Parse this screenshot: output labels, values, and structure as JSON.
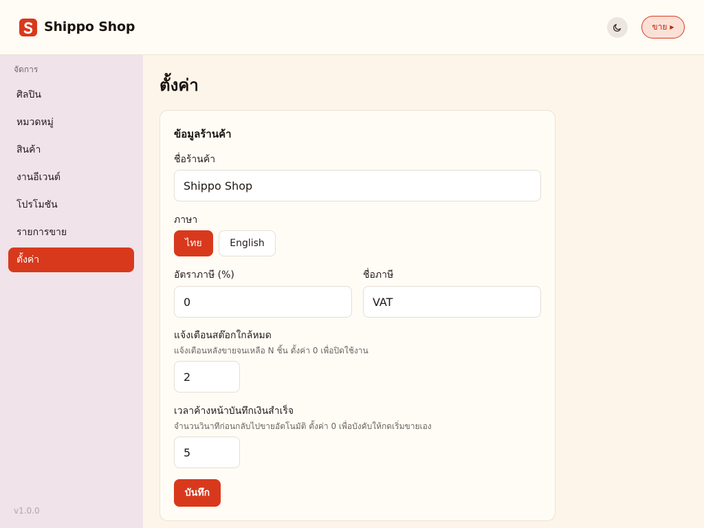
{
  "header": {
    "brand": "Shippo Shop",
    "sell_label": "ขาย",
    "sell_arrow": "▶"
  },
  "sidebar": {
    "heading": "จัดการ",
    "items": [
      {
        "label": "ศิลปิน"
      },
      {
        "label": "หมวดหมู่"
      },
      {
        "label": "สินค้า"
      },
      {
        "label": "งานอีเวนต์"
      },
      {
        "label": "โปรโมชัน"
      },
      {
        "label": "รายการขาย"
      },
      {
        "label": "ตั้งค่า",
        "active": true
      }
    ],
    "version": "v1.0.0"
  },
  "main": {
    "title": "ตั้งค่า",
    "card": {
      "section_title": "ข้อมูลร้านค้า",
      "shop_name_label": "ชื่อร้านค้า",
      "shop_name_value": "Shippo Shop",
      "language_label": "ภาษา",
      "languages": [
        {
          "label": "ไทย",
          "selected": true
        },
        {
          "label": "English",
          "selected": false
        }
      ],
      "tax_rate_label": "อัตราภาษี (%)",
      "tax_rate_value": "0",
      "tax_name_label": "ชื่อภาษี",
      "tax_name_value": "VAT",
      "low_stock_label": "แจ้งเตือนสต๊อกใกล้หมด",
      "low_stock_hint": "แจ้งเตือนหลังขายจนเหลือ N ชิ้น ตั้งค่า 0 เพื่อปิดใช้งาน",
      "low_stock_value": "2",
      "success_delay_label": "เวลาค้างหน้าบันทึกเงินสำเร็จ",
      "success_delay_hint": "จำนวนวินาทีก่อนกลับไปขายอัตโนมัติ ตั้งค่า 0 เพื่อบังคับให้กดเริ่มขายเอง",
      "success_delay_value": "5",
      "save_label": "บันทึก"
    }
  },
  "colors": {
    "accent": "#d8391c",
    "sidebar_bg": "#f0e3e9",
    "page_bg": "#fdf5ea"
  },
  "icons": {
    "logo": "shop-logo-icon",
    "theme": "moon-icon"
  }
}
